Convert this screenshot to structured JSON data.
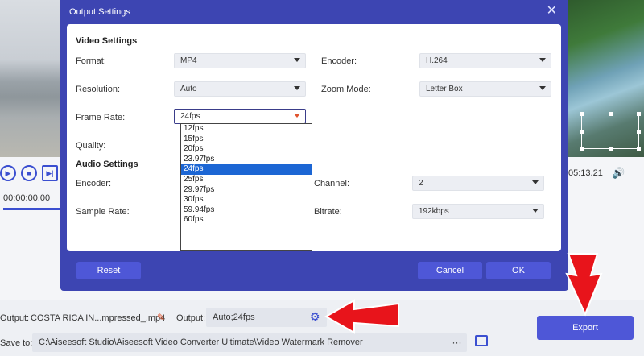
{
  "background": {
    "time_left": "00:00:00.00",
    "time_right": "05:13.21",
    "output_file_label": "Output:",
    "output_file_name": "COSTA RICA IN...mpressed_.mp4",
    "output_format_label": "Output:",
    "output_format_value": "Auto;24fps",
    "save_to_label": "Save to:",
    "save_to_path": "C:\\Aiseesoft Studio\\Aiseesoft Video Converter Ultimate\\Video Watermark Remover",
    "browse_label": "···",
    "export_label": "Export"
  },
  "dialog": {
    "title": "Output Settings",
    "close_glyph": "✕",
    "video_section": "Video Settings",
    "format_label": "Format:",
    "format_value": "MP4",
    "encoder_label": "Encoder:",
    "encoder_value": "H.264",
    "resolution_label": "Resolution:",
    "resolution_value": "Auto",
    "zoom_label": "Zoom Mode:",
    "zoom_value": "Letter Box",
    "frame_rate_label": "Frame Rate:",
    "frame_rate_value": "24fps",
    "quality_label": "Quality:",
    "audio_section": "Audio Settings",
    "audio_encoder_label": "Encoder:",
    "sample_rate_label": "Sample Rate:",
    "channel_label": "Channel:",
    "channel_value": "2",
    "bitrate_label": "Bitrate:",
    "bitrate_value": "192kbps",
    "reset_label": "Reset",
    "cancel_label": "Cancel",
    "ok_label": "OK",
    "frame_rate_options": [
      "12fps",
      "15fps",
      "20fps",
      "23.97fps",
      "24fps",
      "25fps",
      "29.97fps",
      "30fps",
      "59.94fps",
      "60fps"
    ],
    "frame_rate_selected": "24fps"
  },
  "colors": {
    "accent": "#4e57d7",
    "dialog_frame": "#3d45b2",
    "list_highlight": "#1c66d4",
    "annotation_arrow": "#e8141b"
  }
}
